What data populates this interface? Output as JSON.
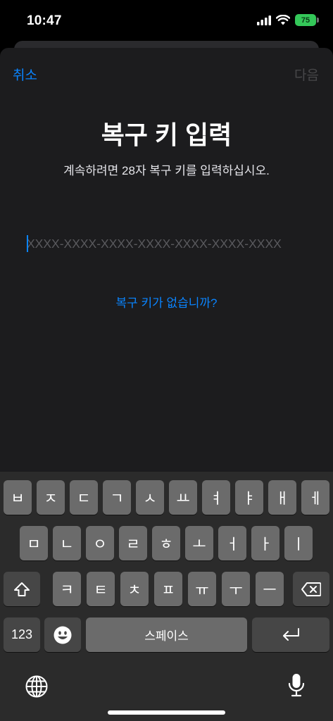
{
  "status_bar": {
    "time": "10:47",
    "battery_level": "75"
  },
  "nav": {
    "cancel_label": "취소",
    "next_label": "다음"
  },
  "content": {
    "title": "복구 키 입력",
    "subtitle": "계속하려면 28자 복구 키를 입력하십시오.",
    "key_input": {
      "value": "",
      "placeholder": "XXXX-XXXX-XXXX-XXXX-XXXX-XXXX-XXXX"
    },
    "no_key_link": "복구 키가 없습니까?"
  },
  "keyboard": {
    "row1": [
      "ㅂ",
      "ㅈ",
      "ㄷ",
      "ㄱ",
      "ㅅ",
      "ㅛ",
      "ㅕ",
      "ㅑ",
      "ㅐ",
      "ㅔ"
    ],
    "row2": [
      "ㅁ",
      "ㄴ",
      "ㅇ",
      "ㄹ",
      "ㅎ",
      "ㅗ",
      "ㅓ",
      "ㅏ",
      "ㅣ"
    ],
    "row3": [
      "ㅋ",
      "ㅌ",
      "ㅊ",
      "ㅍ",
      "ㅠ",
      "ㅜ",
      "ㅡ"
    ],
    "numbers_label": "123",
    "space_label": "스페이스",
    "icons": {
      "shift": "shift-icon",
      "delete": "delete-icon",
      "emoji": "emoji-icon",
      "return": "return-icon",
      "globe": "globe-icon",
      "dictation": "microphone-icon"
    }
  }
}
